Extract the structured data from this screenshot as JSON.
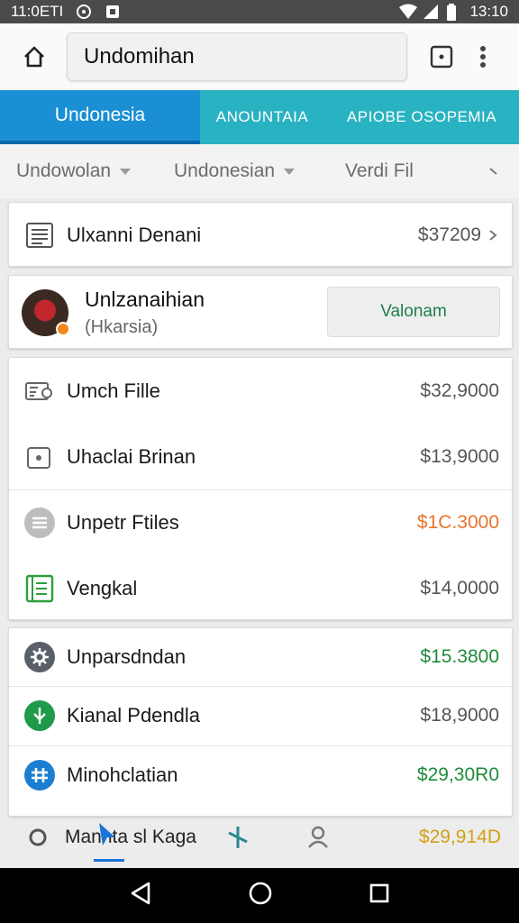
{
  "status_bar": {
    "left_text": "11:0ETI",
    "right_text": "13:10"
  },
  "toolbar": {
    "url_text": "Undomihan"
  },
  "tabs": [
    {
      "label": "Undonesia",
      "active": true
    },
    {
      "label": "ANOUNTAIA",
      "active": false
    },
    {
      "label": "APIOBE OSOPEMIA",
      "active": false
    }
  ],
  "filters": [
    {
      "label": "Undowolan"
    },
    {
      "label": "Undonesian"
    },
    {
      "label": "Verdi Fil"
    }
  ],
  "summary": {
    "label": "Ulxanni Denani",
    "amount": "$37209"
  },
  "profile": {
    "name": "Unlzanaihian",
    "subtitle": "(Hkarsia)",
    "button_label": "Valonam"
  },
  "list1": [
    {
      "icon": "id-card-icon",
      "label": "Umch Fille",
      "amount": "$32,9000",
      "amount_color": "#555555"
    },
    {
      "icon": "camera-icon",
      "label": "Uhaclai Brinan",
      "amount": "$13,9000",
      "amount_color": "#555555"
    },
    {
      "icon": "stack-icon",
      "label": "Unpetr Ftiles",
      "amount": "$1C.3000",
      "amount_color": "#e8742c"
    },
    {
      "icon": "ledger-icon",
      "label": "Vengkal",
      "amount": "$14,0000",
      "amount_color": "#555555"
    }
  ],
  "list2": [
    {
      "icon": "gear-icon",
      "label": "Unparsdndan",
      "amount": "$15.3800",
      "amount_color": "#1e8c3c"
    },
    {
      "icon": "leaf-icon",
      "label": "Kianal Pdendla",
      "amount": "$18,9000",
      "amount_color": "#555555"
    },
    {
      "icon": "grid-icon",
      "label": "Minohclatian",
      "amount": "$29,30R0",
      "amount_color": "#1e8c3c"
    }
  ],
  "bottom_nav": {
    "partial_label": "Manhta sl Kaga",
    "partial_amount": "$29,914D",
    "partial_amount_color": "#d4a017"
  },
  "colors": {
    "tab_active": "#1a8fd4",
    "tab_bar": "#29b2c2",
    "green_amount": "#1e8c3c",
    "orange_amount": "#e8742c"
  }
}
